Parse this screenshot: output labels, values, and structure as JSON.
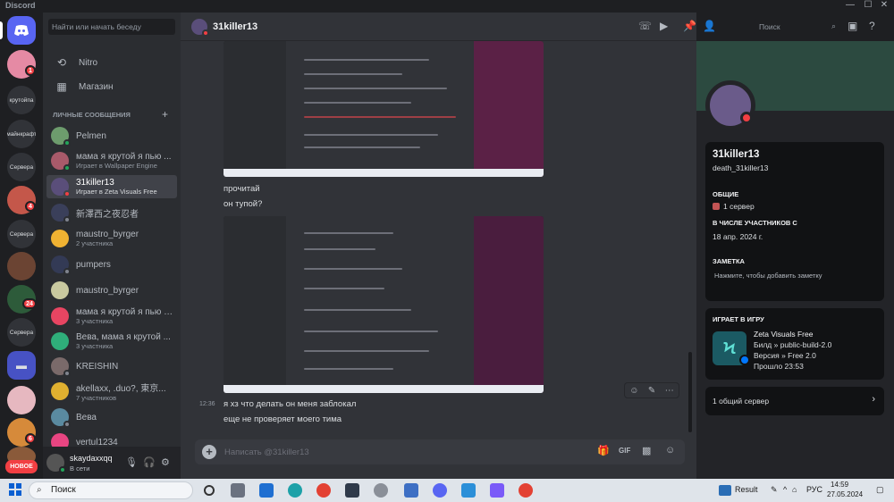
{
  "window": {
    "title": "Discord",
    "controls": [
      "—",
      "☐",
      "✕"
    ]
  },
  "rail": {
    "servers": [
      {
        "label": "",
        "kind": "discord-home"
      },
      {
        "label": "",
        "badge": "1"
      },
      {
        "label": "крутойпа"
      },
      {
        "label": "майнкрафт"
      },
      {
        "label": "Сервера"
      },
      {
        "label": "",
        "badge": "4"
      },
      {
        "label": "Сервера"
      },
      {
        "label": ""
      },
      {
        "label": "",
        "badge": "24"
      },
      {
        "label": "Сервера"
      },
      {
        "label": ""
      },
      {
        "label": ""
      },
      {
        "label": "",
        "badge": "6"
      },
      {
        "label": ""
      }
    ],
    "new_label": "НОВОЕ"
  },
  "sidebar": {
    "search_placeholder": "Найти или начать беседу",
    "nav": [
      {
        "label": "Nitro",
        "icon": "nitro-icon"
      },
      {
        "label": "Магазин",
        "icon": "shop-icon"
      }
    ],
    "dm_header": "ЛИЧНЫЕ СООБЩЕНИЯ",
    "dm_add": "+",
    "dms": [
      {
        "name": "Pelmen",
        "sub": "",
        "status": "online",
        "color": "#6d9c6d"
      },
      {
        "name": "мама я крутой я пью ...",
        "sub": "Играет в Wallpaper Engine",
        "status": "online",
        "color": "#a85a6a"
      },
      {
        "name": "31killer13",
        "sub": "Играет в Zeta Visuals Free",
        "status": "dnd",
        "color": "#5a4e7a",
        "selected": true
      },
      {
        "name": "新澤西之夜忍者",
        "sub": "",
        "status": "offline",
        "color": "#3a3f5a"
      },
      {
        "name": "maustro_byrger",
        "sub": "2 участника",
        "status": "",
        "color": "#f0b232"
      },
      {
        "name": "pumpers",
        "sub": "",
        "status": "offline",
        "color": "#333a55"
      },
      {
        "name": "maustro_byrger",
        "sub": "",
        "status": "",
        "color": "#c9c9a0"
      },
      {
        "name": "мама я крутой я пью о...",
        "sub": "3 участника",
        "status": "",
        "color": "#e84562"
      },
      {
        "name": "Вева, мама я крутой ...",
        "sub": "3 участника",
        "status": "",
        "color": "#2fae7a"
      },
      {
        "name": "KREISHIN",
        "sub": "",
        "status": "offline",
        "color": "#7a6a6a"
      },
      {
        "name": "akellaxx, .duo?, 東京...",
        "sub": "7 участников",
        "status": "",
        "color": "#e0b030"
      },
      {
        "name": "Вева",
        "sub": "",
        "status": "offline",
        "color": "#5a8aa0"
      },
      {
        "name": "vertul1234",
        "sub": "",
        "status": "",
        "color": "#e84582"
      }
    ]
  },
  "user_panel": {
    "name": "skaydaxxqq",
    "status": "В сети"
  },
  "chat": {
    "recipient": "31killer13",
    "messages": [
      {
        "time": "",
        "text": "прочитай"
      },
      {
        "time": "",
        "text": "он тупой?"
      },
      {
        "time": "12:36",
        "text": "я хз что делать он меня заблокал"
      },
      {
        "time": "",
        "text": "еще не проверяет моего тима"
      }
    ],
    "composer_placeholder": "Написать @31killer13",
    "header_search_placeholder": "Поиск"
  },
  "profile": {
    "display_name": "31killer13",
    "username": "death_31killer13",
    "common_label": "ОБЩИЕ",
    "common_value": "1 сервер",
    "member_since_label": "В ЧИСЛЕ УЧАСТНИКОВ С",
    "member_since": "18 апр. 2024 г.",
    "note_label": "ЗАМЕТКА",
    "note_placeholder": "Нажмите, чтобы добавить заметку",
    "playing_label": "ИГРАЕТ В ИГРУ",
    "game_name": "Zeta Visuals Free",
    "game_build": "Билд » public-build-2.0",
    "game_version": "Версия » Free 2.0",
    "game_elapsed": "Прошло 23:53",
    "mutual_servers": "1 общий сервер"
  },
  "taskbar": {
    "search_placeholder": "Поиск",
    "tray_app": "Result",
    "lang": "РУС",
    "time": "14:59",
    "date": "27.05.2024"
  }
}
